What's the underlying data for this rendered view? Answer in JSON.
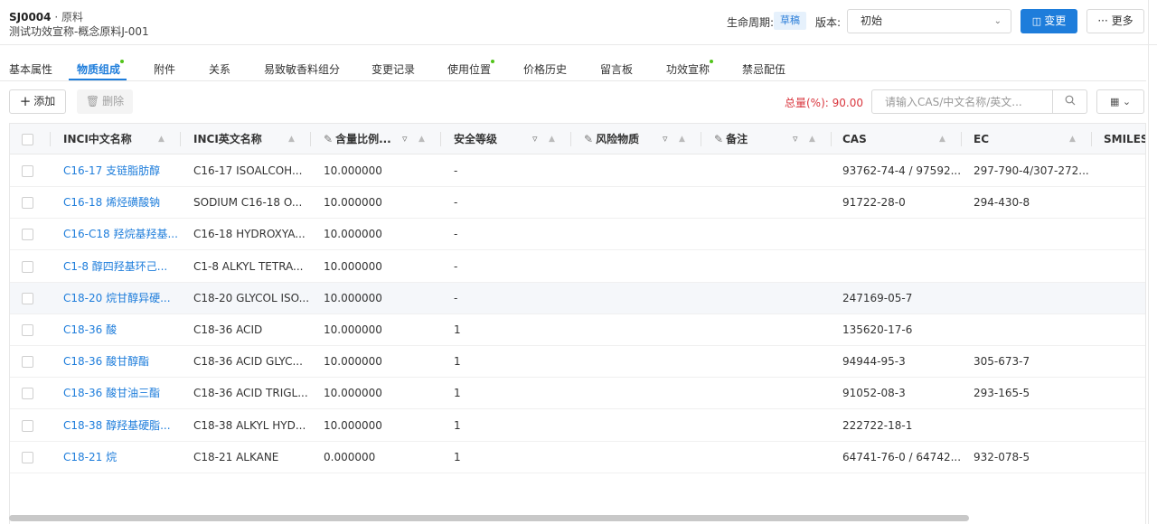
{
  "header": {
    "code": "SJ0004",
    "kind": " · 原料",
    "subtitle": "测试功效宣称-概念原料J-001",
    "lifecycle_label": "生命周期:",
    "lifecycle_value": "草稿",
    "version_label": "版本:",
    "version_value": "初始",
    "change_button": "变更",
    "more_button": "更多"
  },
  "tabs": [
    {
      "label": "基本属性"
    },
    {
      "label": "物质组成"
    },
    {
      "label": "附件"
    },
    {
      "label": "关系"
    },
    {
      "label": "易致敏香料组分"
    },
    {
      "label": "变更记录"
    },
    {
      "label": "使用位置"
    },
    {
      "label": "价格历史"
    },
    {
      "label": "留言板"
    },
    {
      "label": "功效宣称"
    },
    {
      "label": "禁忌配伍"
    }
  ],
  "toolbar": {
    "add_label": "添加",
    "delete_label": "删除",
    "total_label": "总量(%):",
    "total_value": "90.00",
    "search_placeholder": "请输入CAS/中文名称/英文..."
  },
  "columns": [
    "INCI中文名称",
    "INCI英文名称",
    "含量比例...",
    "安全等级",
    "风险物质",
    "备注",
    "CAS",
    "EC",
    "SMILES"
  ],
  "rows": [
    {
      "cn": "C16-17 支链脂肪醇",
      "en": "C16-17 ISOALCOH...",
      "ratio": "10.000000",
      "safety": "-",
      "cas": "93762-74-4 / 97592...",
      "ec": "297-790-4/307-272..."
    },
    {
      "cn": "C16-18 烯烃磺酸钠",
      "en": "SODIUM C16-18 O...",
      "ratio": "10.000000",
      "safety": "-",
      "cas": "91722-28-0",
      "ec": "294-430-8"
    },
    {
      "cn": "C16-C18 羟烷基羟基...",
      "en": "C16-18 HYDROXYA...",
      "ratio": "10.000000",
      "safety": "-",
      "cas": "",
      "ec": ""
    },
    {
      "cn": "C1-8 醇四羟基环己...",
      "en": "C1-8 ALKYL TETRA...",
      "ratio": "10.000000",
      "safety": "-",
      "cas": "",
      "ec": ""
    },
    {
      "cn": "C18-20 烷甘醇异硬...",
      "en": "C18-20 GLYCOL ISO...",
      "ratio": "10.000000",
      "safety": "-",
      "cas": "247169-05-7",
      "ec": ""
    },
    {
      "cn": "C18-36 酸",
      "en": "C18-36 ACID",
      "ratio": "10.000000",
      "safety": "1",
      "cas": "135620-17-6",
      "ec": ""
    },
    {
      "cn": "C18-36 酸甘醇酯",
      "en": "C18-36 ACID GLYC...",
      "ratio": "10.000000",
      "safety": "1",
      "cas": "94944-95-3",
      "ec": "305-673-7"
    },
    {
      "cn": "C18-36 酸甘油三酯",
      "en": "C18-36 ACID TRIGL...",
      "ratio": "10.000000",
      "safety": "1",
      "cas": "91052-08-3",
      "ec": "293-165-5"
    },
    {
      "cn": "C18-38 醇羟基硬脂...",
      "en": "C18-38 ALKYL HYD...",
      "ratio": "10.000000",
      "safety": "1",
      "cas": "222722-18-1",
      "ec": ""
    },
    {
      "cn": "C18-21 烷",
      "en": "C18-21 ALKANE",
      "ratio": "0.000000",
      "safety": "1",
      "cas": "64741-76-0 / 64742...",
      "ec": "932-078-5"
    }
  ],
  "colors": {
    "accent": "#1e7ddb",
    "danger": "#d9363e",
    "dot": "#52c41a"
  }
}
